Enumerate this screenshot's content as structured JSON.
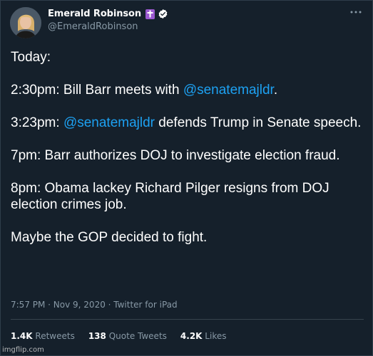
{
  "author": {
    "display_name": "Emerald Robinson",
    "handle": "@EmeraldRobinson"
  },
  "tweet": {
    "line1": "Today:",
    "line2_before": "2:30pm: Bill Barr meets with ",
    "line2_mention": "@senatemajldr",
    "line2_after": ".",
    "line3_before": "3:23pm: ",
    "line3_mention": "@senatemajldr",
    "line3_after": " defends Trump in Senate speech.",
    "line4": "7pm: Barr authorizes DOJ to investigate election fraud.",
    "line5": "8pm: Obama lackey Richard Pilger resigns from DOJ election crimes job.",
    "line6": "Maybe the GOP decided to fight."
  },
  "meta": {
    "timestamp": "7:57 PM · Nov 9, 2020 · Twitter for iPad"
  },
  "stats": {
    "retweets_count": "1.4K",
    "retweets_label": "Retweets",
    "quotes_count": "138",
    "quotes_label": "Quote Tweets",
    "likes_count": "4.2K",
    "likes_label": "Likes"
  },
  "watermark": "imgflip.com",
  "colors": {
    "background": "#15202b",
    "mention": "#1da1f2",
    "muted": "#8899a6",
    "badge_purple": "#9b59d0"
  },
  "icons": {
    "badge": "cross-icon",
    "verified": "verified-badge-icon",
    "more": "more-options-icon"
  }
}
